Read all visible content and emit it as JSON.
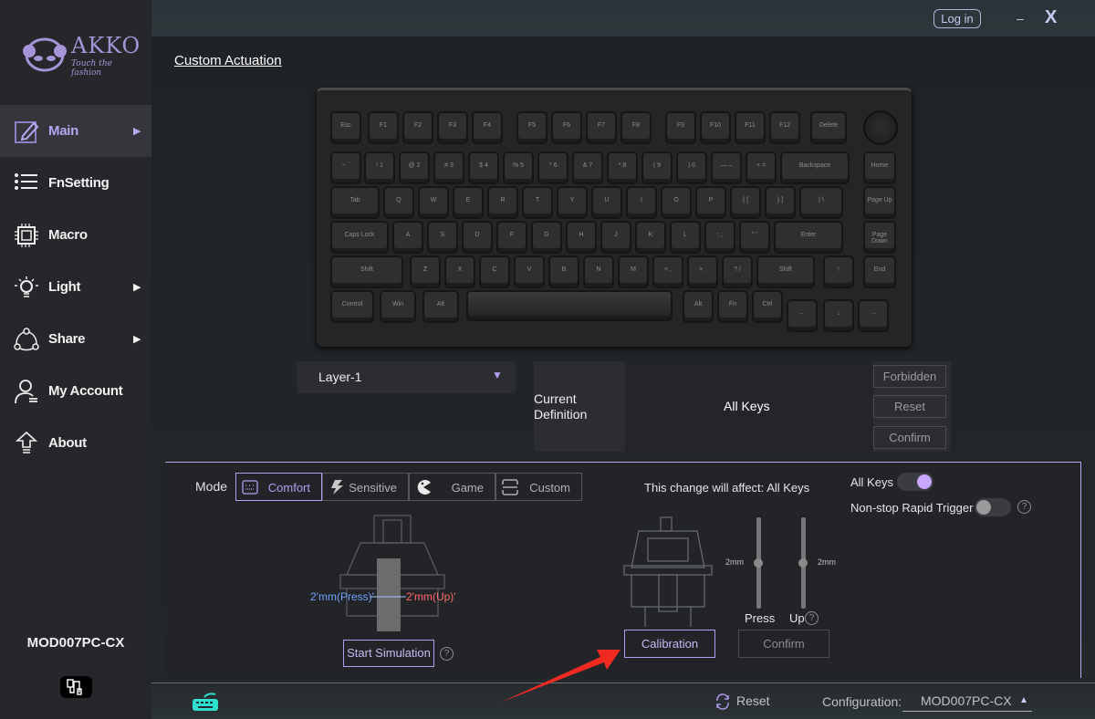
{
  "app": {
    "brand": "AKKO",
    "tagline": "Touch the fashion"
  },
  "window": {
    "login": "Log in",
    "minimize": "–",
    "close": "X"
  },
  "sidebar": {
    "items": [
      {
        "label": "Main",
        "icon": "edit-icon",
        "has_arrow": true,
        "active": true
      },
      {
        "label": "FnSetting",
        "icon": "list-icon",
        "has_arrow": false
      },
      {
        "label": "Macro",
        "icon": "chip-icon",
        "has_arrow": false
      },
      {
        "label": "Light",
        "icon": "bulb-icon",
        "has_arrow": true
      },
      {
        "label": "Share",
        "icon": "share-icon",
        "has_arrow": true
      },
      {
        "label": "My Account",
        "icon": "user-icon",
        "has_arrow": false
      },
      {
        "label": "About",
        "icon": "upload-icon",
        "has_arrow": false
      }
    ],
    "arrow": "▶",
    "device": "MOD007PC-CX",
    "connection_icon": "usb-cable-icon"
  },
  "page": {
    "title": "Custom Actuation"
  },
  "keyboard": {
    "rows": [
      [
        "Esc",
        "F1",
        "F2",
        "F3",
        "F4",
        "F5",
        "F6",
        "F7",
        "F8",
        "F9",
        "F10",
        "F11",
        "F12",
        "Delete"
      ],
      [
        "~ `",
        "! 1",
        "@ 2",
        "# 3",
        "$ 4",
        "% 5",
        "^ 6",
        "& 7",
        "* 8",
        "( 9",
        ") 0",
        "— –",
        "+ =",
        "Backspace",
        "Home"
      ],
      [
        "Tab",
        "Q",
        "W",
        "E",
        "R",
        "T",
        "Y",
        "U",
        "I",
        "O",
        "P",
        "{ [",
        "} ]",
        "| \\",
        "Page Up"
      ],
      [
        "Caps Lock",
        "A",
        "S",
        "D",
        "F",
        "G",
        "H",
        "J",
        "K",
        "L",
        ": ;",
        "\" '",
        "Enter",
        "Page Down"
      ],
      [
        "Shift",
        "Z",
        "X",
        "C",
        "V",
        "B",
        "N",
        "M",
        "< ,",
        "> .",
        "? /",
        "Shift",
        "↑",
        "End"
      ],
      [
        "Control",
        "Win",
        "Alt",
        "",
        "Alt",
        "Fn",
        "Ctrl",
        "←",
        "↓",
        "→"
      ]
    ]
  },
  "layer": {
    "selected": "Layer-1",
    "arrow": "▼"
  },
  "definition": {
    "label": "Current Definition",
    "value": "All Keys",
    "buttons": [
      "Forbidden",
      "Reset",
      "Confirm"
    ]
  },
  "mode": {
    "label": "Mode",
    "options": [
      {
        "label": "Comfort",
        "icon": "keyboard-icon",
        "active": true
      },
      {
        "label": "Sensitive",
        "icon": "lightning-icon"
      },
      {
        "label": "Game",
        "icon": "pacman-icon"
      },
      {
        "label": "Custom",
        "icon": "custom-frame-icon"
      }
    ]
  },
  "simulation": {
    "press": "2'mm(Press)'",
    "up": "2'mm(Up)'",
    "button": "Start Simulation",
    "help": "?"
  },
  "actuation": {
    "affect_label": "This change will affect:",
    "affect_value": "All Keys",
    "press_value": "2mm",
    "up_value": "2mm",
    "press_label": "Press",
    "up_label": "Up",
    "press_fraction": 0.5,
    "up_fraction": 0.5,
    "calibration": "Calibration",
    "confirm": "Confirm",
    "help": "?"
  },
  "toggles": {
    "all_keys": {
      "label": "All Keys",
      "on": true
    },
    "nonstop": {
      "label": "Non-stop Rapid Trigger",
      "on": false
    }
  },
  "footer": {
    "reset": "Reset",
    "config_label": "Configuration:",
    "config_value": "MOD007PC-CX",
    "config_arrow": "▲"
  },
  "colors": {
    "accent": "#b59cf0",
    "press": "#6fa2ff",
    "up": "#ff6b6b",
    "teal": "#2fe0d0",
    "arrow": "#f02a20"
  }
}
